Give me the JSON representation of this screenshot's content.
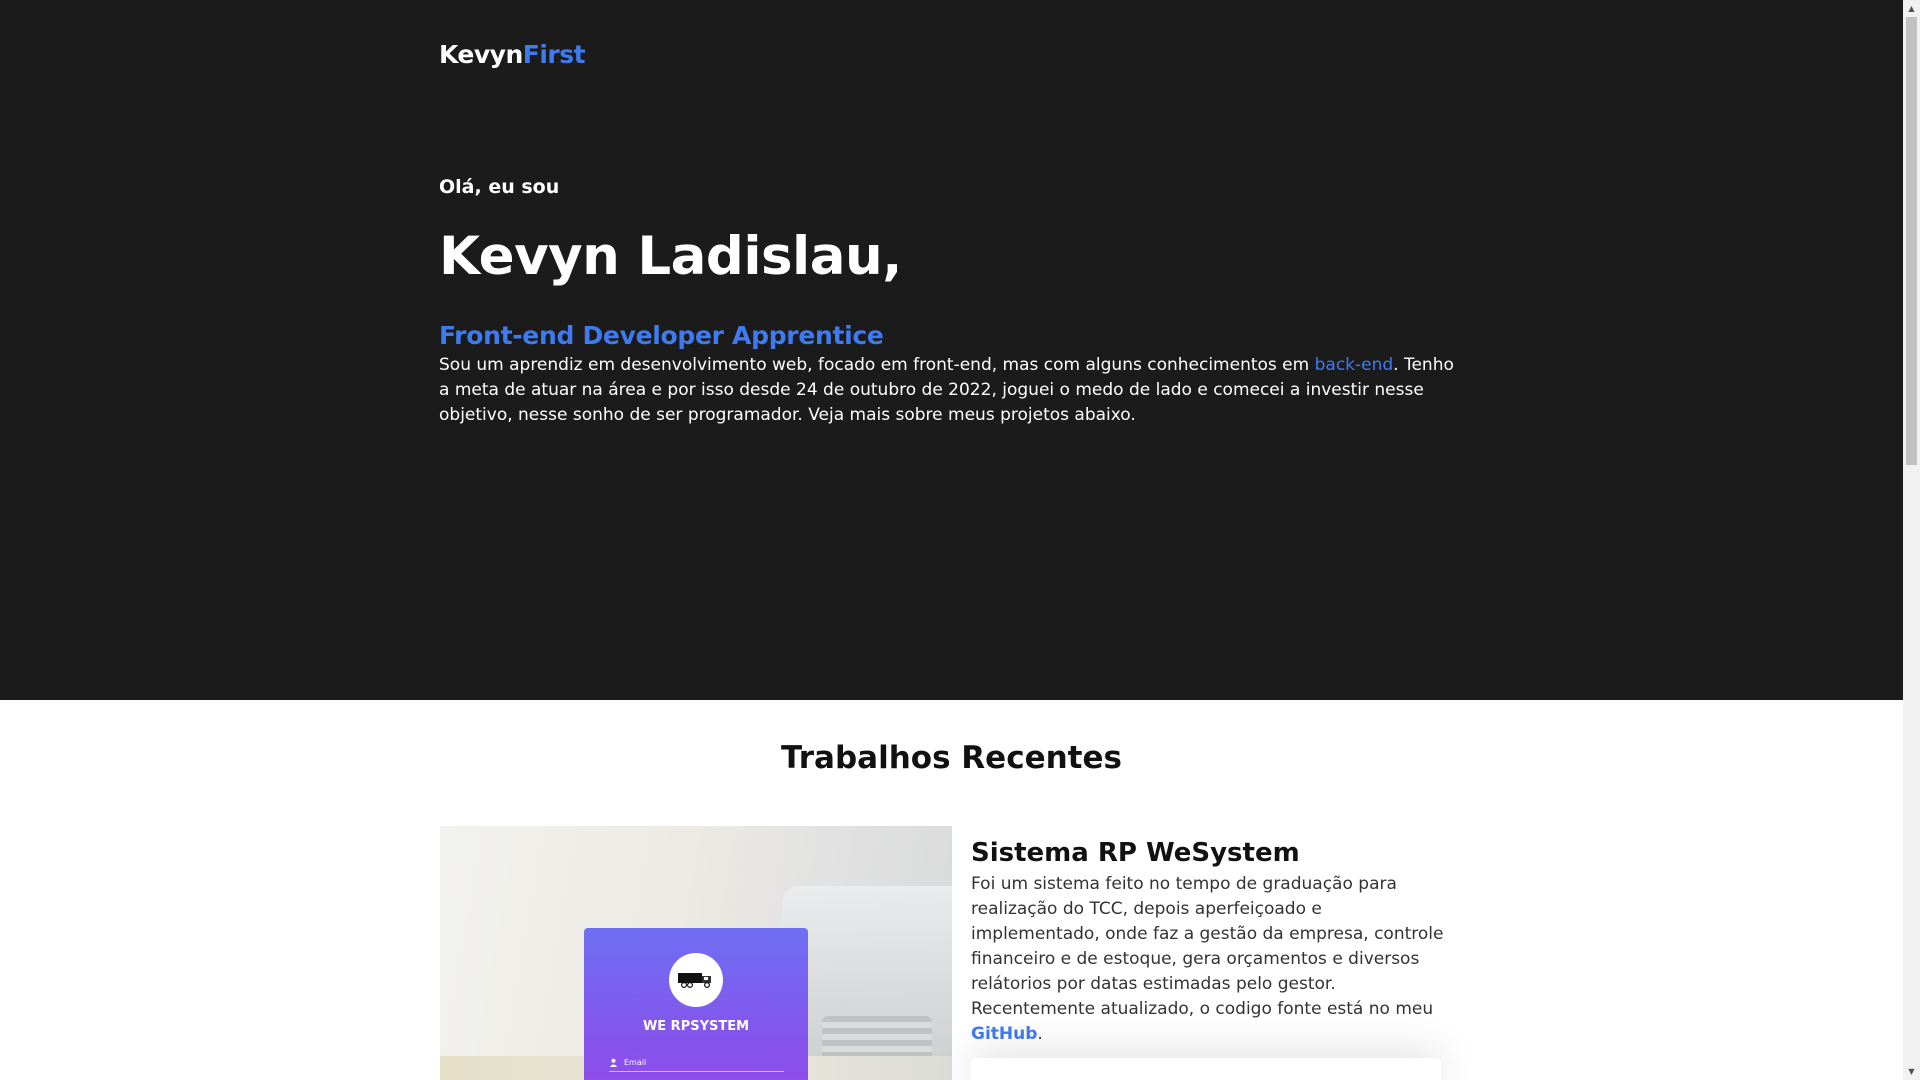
{
  "header": {
    "logo_primary": "Kevyn",
    "logo_accent": "First"
  },
  "hero": {
    "greeting": "Olá, eu sou",
    "name": "Kevyn Ladislau,",
    "role": "Front-end Developer Apprentice",
    "bio_before_link": "Sou um aprendiz em desenvolvimento web, focado em front-end, mas com alguns conhecimentos em ",
    "bio_link": "back-end",
    "bio_after_link": ". Tenho a meta de atuar na área e por isso desde 24 de outubro de 2022, joguei o medo de lado e comecei a investir nesse objetivo, nesse sonho de ser programador. Veja mais sobre meus projetos abaixo."
  },
  "works": {
    "section_title": "Trabalhos Recentes",
    "projects": [
      {
        "image_card_title": "WE RPSYSTEM",
        "image_field_label": "Email",
        "title": "Sistema RP WeSystem",
        "description_before_link": "Foi um sistema feito no tempo de graduação para realização do TCC, depois aperfeiçoado e implementado, onde faz a gestão da empresa, controle financeiro e de estoque, gera orçamentos e diversos relátorios por datas estimadas pelo gestor. Recentemente atualizado, o codigo fonte está no meu ",
        "description_link": "GitHub",
        "description_after_link": "."
      }
    ]
  },
  "colors": {
    "accent": "#3f7bf0",
    "hero_background": "#1b1b1b",
    "card_gradient_start": "#6f6ff2",
    "card_gradient_end": "#8f4cea"
  },
  "icons": {
    "truck_logo": "truck-icon",
    "field_user": "user-icon",
    "scroll_up": "arrow-up-icon",
    "scroll_down": "arrow-down-icon"
  }
}
